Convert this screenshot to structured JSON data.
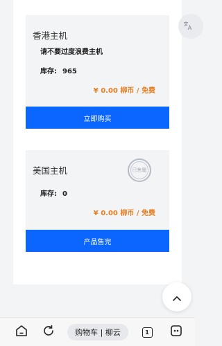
{
  "products": [
    {
      "name": "香港主机",
      "desc": "请不要过度浪费主机",
      "stock_label": "库存:",
      "stock_value": "965",
      "price": "¥ 0.00 柳币 / 免费",
      "button": "立即购买"
    },
    {
      "name": "美国主机",
      "stock_label": "库存:",
      "stock_value": "0",
      "price": "¥ 0.00 柳币 / 免费",
      "button": "产品售完",
      "stamp": "已售罄"
    }
  ],
  "browser": {
    "url_title": "购物车 | 柳云",
    "tab_count": "1"
  },
  "colors": {
    "accent": "#0a66ff",
    "price": "#e67e22"
  },
  "icons": {
    "translate": "translate-icon",
    "scroll_top": "chevron-up-icon",
    "home": "home-icon",
    "reload": "reload-icon",
    "tabs": "tabs-icon",
    "menu": "menu-icon"
  }
}
